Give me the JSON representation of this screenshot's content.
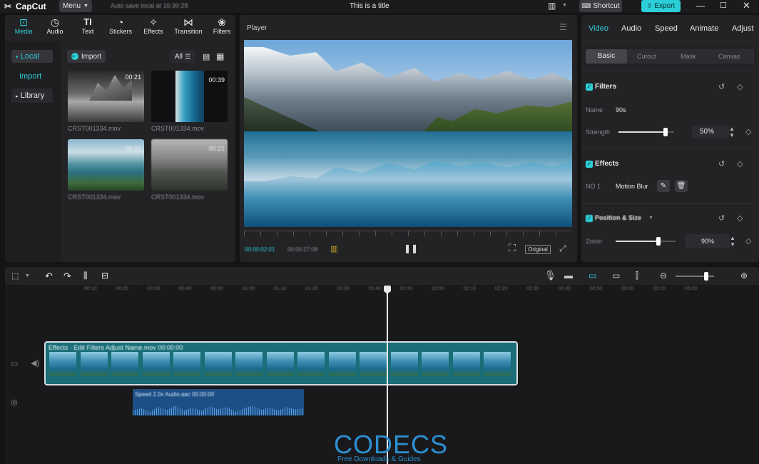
{
  "app": {
    "name": "CapCut",
    "menu_label": "Menu",
    "autosave": "Auto save local at 16:30:28",
    "title": "This is a title",
    "shortcut_label": "Shortcut",
    "export_label": "Export"
  },
  "colors": {
    "accent": "#2ccfd8",
    "background": "#141416",
    "panel": "#232326",
    "clip_border": "#1a8a94",
    "audio_clip": "#1d4f86"
  },
  "media_tabs": [
    {
      "label": "Media",
      "icon": "media-icon",
      "active": true
    },
    {
      "label": "Audio",
      "icon": "audio-icon"
    },
    {
      "label": "Text",
      "icon": "text-icon"
    },
    {
      "label": "Stickers",
      "icon": "stickers-icon"
    },
    {
      "label": "Effects",
      "icon": "effects-icon"
    },
    {
      "label": "Transition",
      "icon": "transition-icon"
    },
    {
      "label": "Filters",
      "icon": "filters-icon"
    }
  ],
  "media_nav": {
    "local": "Local",
    "import": "Import",
    "library": "Library"
  },
  "media_toolbar": {
    "import_label": "Import",
    "filter_label": "All"
  },
  "media_items": [
    {
      "name": "CRST001334.mov",
      "duration": "00:21"
    },
    {
      "name": "CRST001334.mov",
      "duration": "00:39"
    },
    {
      "name": "CRST001334.mov",
      "duration": "00:21"
    },
    {
      "name": "CRST001334.mov",
      "duration": "00:21"
    }
  ],
  "player": {
    "title": "Player",
    "current_time": "00:00:02:01",
    "total_time": "00:00:27:08",
    "ratio_label": "Original"
  },
  "inspector": {
    "tabs": [
      "Video",
      "Audio",
      "Speed",
      "Animate",
      "Adjust"
    ],
    "subtabs": [
      "Basic",
      "Cutout",
      "Mask",
      "Canvas"
    ],
    "filters": {
      "title": "Filters",
      "name_label": "Name",
      "name_value": "90s",
      "strength_label": "Strength",
      "strength_value": "50%",
      "strength_level": 0.85
    },
    "effects": {
      "title": "Effects",
      "item_label": "NO 1",
      "item_value": "Motion Blur"
    },
    "position": {
      "title": "Position & Size",
      "zoom_label": "Zoom",
      "zoom_value": "90%",
      "zoom_level": 0.72
    }
  },
  "timeline": {
    "ruler": [
      "00:10",
      "00:20",
      "00:30",
      "00:40",
      "00:50",
      "01:00",
      "01:10",
      "01:20",
      "01:30",
      "01:40",
      "01:50",
      "02:00",
      "02:10",
      "02:20",
      "02:30",
      "02:40",
      "02:50",
      "03:00",
      "03:10",
      "03:20"
    ],
    "video_clip_label": "Effects · Edit   Filters   Adjust   Name.mov   00:00:00",
    "audio_clip_label": "Speed 2.0x   Audio.aac   00:00:00"
  },
  "watermark": {
    "title": "CODECS",
    "subtitle": "Free Downloads & Guides"
  }
}
